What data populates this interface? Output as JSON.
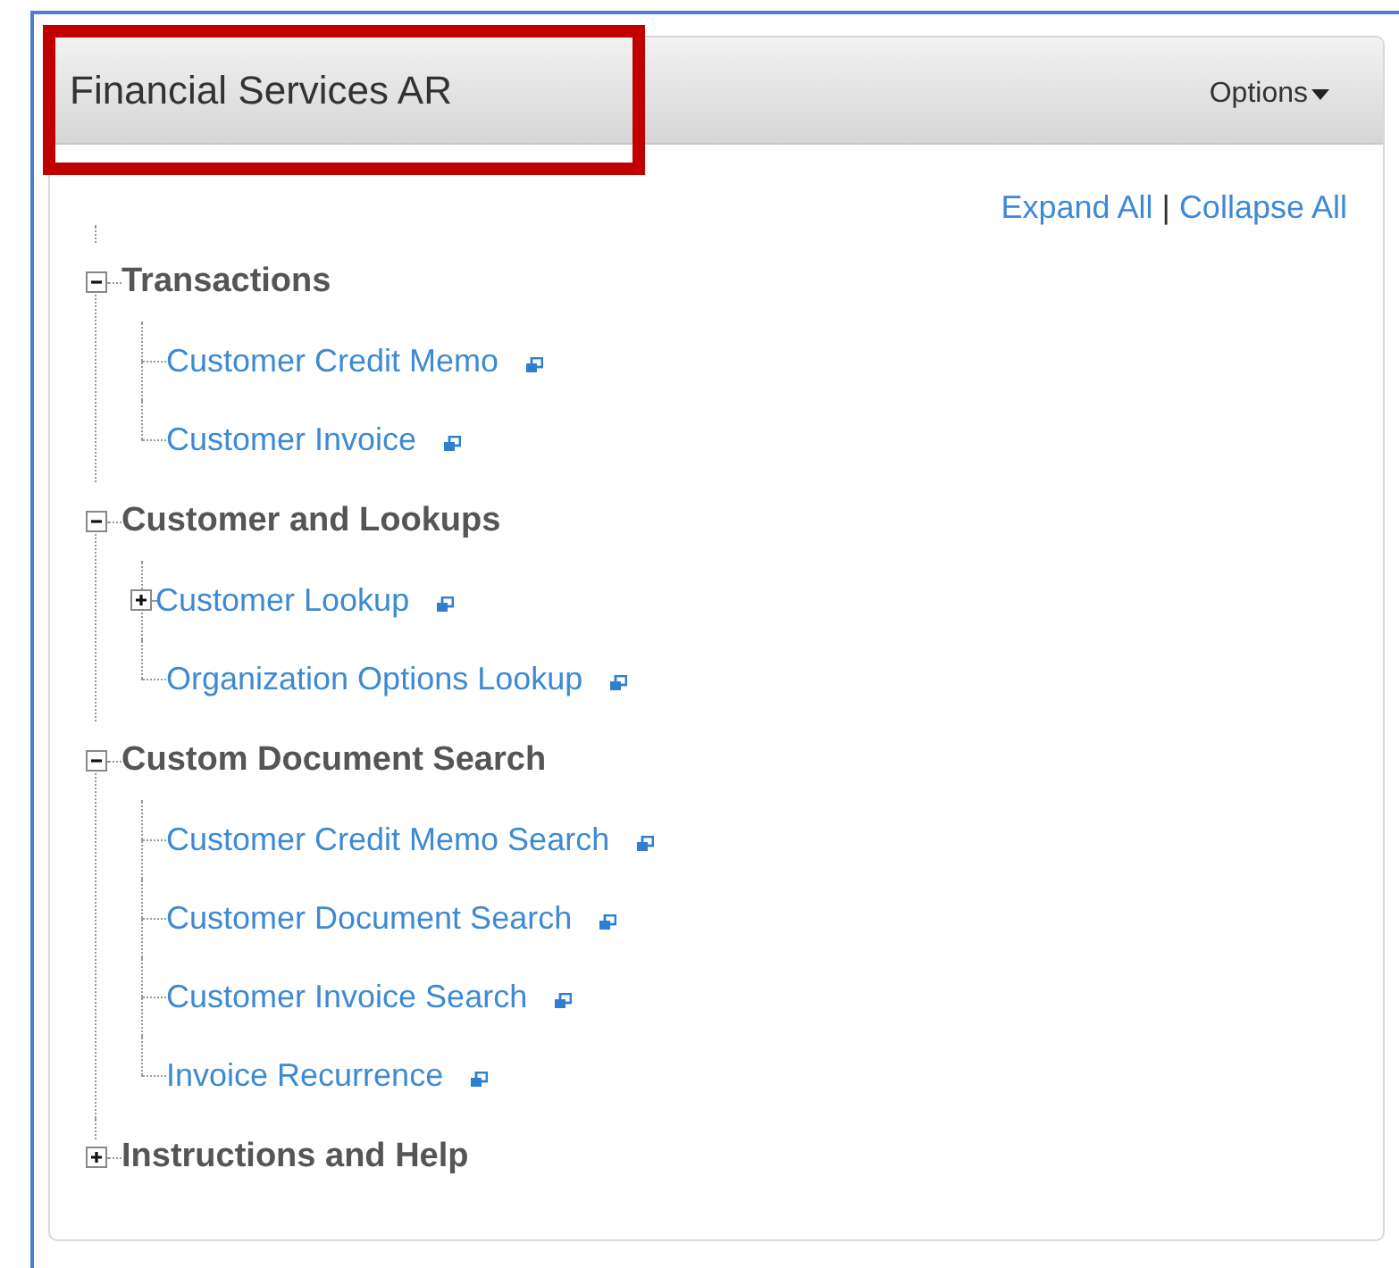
{
  "panel": {
    "title": "Financial Services AR",
    "options_menu": "Options",
    "expand_all": "Expand All",
    "separator": "|",
    "collapse_all": "Collapse All"
  },
  "tree": [
    {
      "label": "Transactions",
      "expanded": true,
      "children": [
        {
          "label": "Customer Credit Memo",
          "expandable": false
        },
        {
          "label": "Customer Invoice",
          "expandable": false
        }
      ]
    },
    {
      "label": "Customer and Lookups",
      "expanded": true,
      "children": [
        {
          "label": "Customer Lookup",
          "expandable": true
        },
        {
          "label": "Organization Options Lookup",
          "expandable": false
        }
      ]
    },
    {
      "label": "Custom Document Search",
      "expanded": true,
      "children": [
        {
          "label": "Customer Credit Memo Search",
          "expandable": false
        },
        {
          "label": "Customer Document Search",
          "expandable": false
        },
        {
          "label": "Customer Invoice Search",
          "expandable": false
        },
        {
          "label": "Invoice Recurrence",
          "expandable": false
        }
      ]
    },
    {
      "label": "Instructions and Help",
      "expanded": false
    }
  ]
}
